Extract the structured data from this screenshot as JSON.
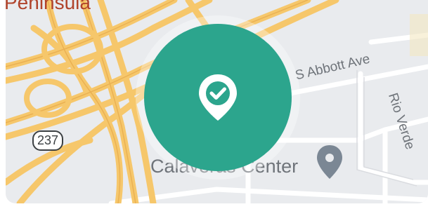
{
  "map": {
    "area_label": "Peninsula",
    "street_1": "S Abbott Ave",
    "street_2": "Rio Verde",
    "poi_label": "Calaveras Center",
    "route_number": "237",
    "marker_icon": "location-check-icon",
    "poi_icon": "map-pin-icon",
    "colors": {
      "marker": "#2ca58d",
      "highway": "#f6c76b",
      "land": "#e9ebee",
      "road": "#ffffff"
    }
  }
}
